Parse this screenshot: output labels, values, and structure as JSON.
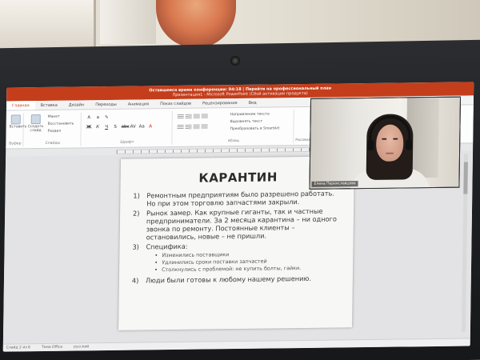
{
  "window": {
    "title_line1": "Оставшееся время конференции: 04:18 | Перейти на профессиональный план",
    "title_line2": "Презентация1 - Microsoft PowerPoint (Сбой активации продукта)"
  },
  "ribbon": {
    "tabs": [
      "Главная",
      "Вставка",
      "Дизайн",
      "Переходы",
      "Анимация",
      "Показ слайдов",
      "Рецензирование",
      "Вид"
    ],
    "active_tab": "Главная",
    "clipboard": {
      "label": "Буфер",
      "paste": "Вставить"
    },
    "slides": {
      "label": "Слайды",
      "new_slide": "Создать слайд",
      "layout": "Макет",
      "reset": "Восстановить",
      "section": "Раздел"
    },
    "font": {
      "label": "Шрифт"
    },
    "paragraph": {
      "label": "Абзац",
      "direction": "Направление текста",
      "align": "Выровнять текст",
      "smartart": "Преобразовать в SmartArt"
    },
    "drawing": {
      "label": "Рисование"
    }
  },
  "slide": {
    "title": "КАРАНТИН",
    "items": [
      {
        "num": "1)",
        "text": "Ремонтным предприятиям было разрешено работать. Но при этом торговлю запчастями закрыли."
      },
      {
        "num": "2)",
        "text": "Рынок замер. Как крупные гиганты, так и частные предприниматели. За 2 месяца карантина – ни одного звонка по ремонту. Постоянные клиенты – остановились, новые – не пришли."
      },
      {
        "num": "3)",
        "text": "Специфика:"
      },
      {
        "num": "4)",
        "text": "Люди были готовы к любому нашему решению."
      }
    ],
    "sub_items": [
      "Изменились поставщики",
      "Удлинились сроки поставки запчастей",
      "Столкнулись с проблемой: не купить болты, гайки."
    ]
  },
  "video": {
    "name": "Елена Переяславцева"
  },
  "status": {
    "slide": "Слайд 2 из 6",
    "theme": "Тема Office",
    "lang": "русский"
  }
}
